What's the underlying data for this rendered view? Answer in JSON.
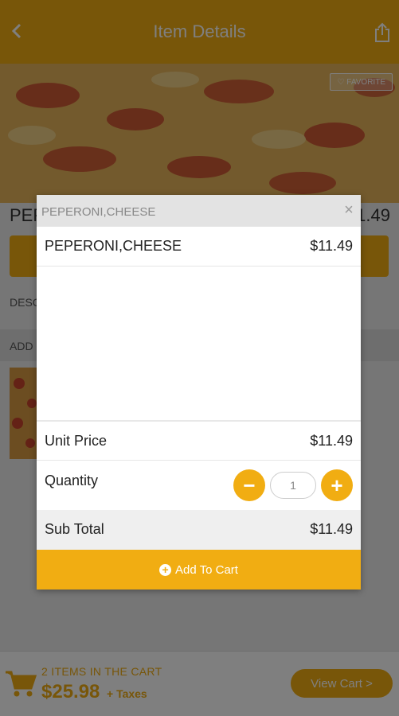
{
  "header": {
    "title": "Item Details",
    "back_icon": "chevron-left-icon",
    "share_icon": "share-icon"
  },
  "hero": {
    "favorite_label": "FAVORITE"
  },
  "item": {
    "name": "PEPERONI,CHEESE",
    "price": "$11.49"
  },
  "sections": {
    "description_label": "DESC",
    "addons_label": "ADD"
  },
  "cart_bar": {
    "count_label": "2 ITEMS IN THE CART",
    "total": "$25.98",
    "taxes_label": "+ Taxes",
    "view_cart_label": "View Cart >"
  },
  "modal": {
    "title": "PEPERONI,CHEESE",
    "close_label": "×",
    "item_name": "PEPERONI,CHEESE",
    "item_price": "$11.49",
    "unit_price_label": "Unit Price",
    "unit_price_value": "$11.49",
    "quantity_label": "Quantity",
    "minus_label": "−",
    "plus_label": "+",
    "quantity_value": "1",
    "subtotal_label": "Sub Total",
    "subtotal_value": "$11.49",
    "add_to_cart_label": "Add To Cart"
  },
  "colors": {
    "accent": "#f1ad12",
    "overlay": "rgba(0,0,0,0.5)"
  }
}
